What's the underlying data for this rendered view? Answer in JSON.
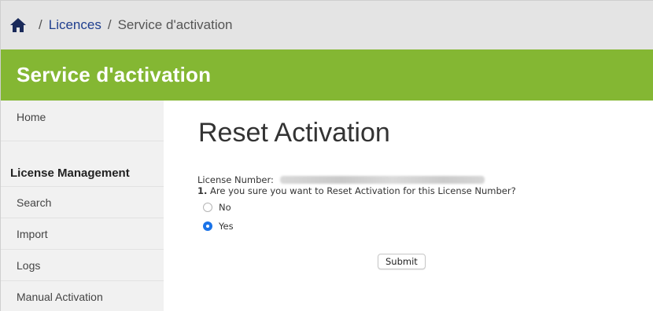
{
  "breadcrumb": {
    "separator": "/",
    "licences": "Licences",
    "current": "Service d'activation"
  },
  "banner": {
    "title": "Service d'activation",
    "color": "#84b733"
  },
  "sidebar": {
    "home": "Home",
    "section_heading": "License Management",
    "items": [
      {
        "label": "Search"
      },
      {
        "label": "Import"
      },
      {
        "label": "Logs"
      },
      {
        "label": "Manual Activation"
      }
    ]
  },
  "main": {
    "title": "Reset Activation",
    "license_label": "License Number:",
    "question_number": "1.",
    "question_text": "Are you sure you want to Reset Activation for this License Number?",
    "options": [
      {
        "label": "No",
        "selected": false
      },
      {
        "label": "Yes",
        "selected": true
      }
    ],
    "submit_label": "Submit"
  },
  "icons": {
    "home": "home-icon",
    "license_value": "blurred-license-number"
  },
  "colors": {
    "accent": "#84b733",
    "link": "#1f3f8f",
    "radio_selected": "#1a73e8"
  }
}
